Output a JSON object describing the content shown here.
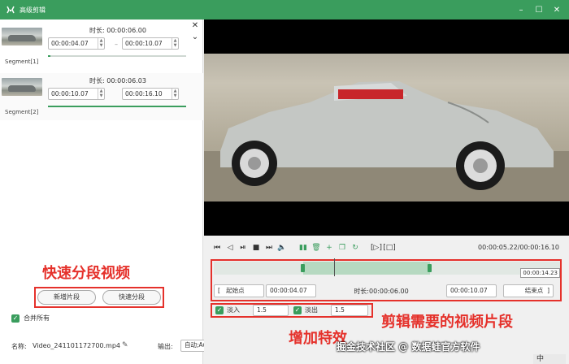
{
  "window": {
    "title": "高级剪辑"
  },
  "segments": [
    {
      "label": "Segment[1]",
      "duration_label": "时长:",
      "duration": "00:00:06.00",
      "start": "00:00:04.07",
      "end": "00:00:10.07",
      "progress": 0.0
    },
    {
      "label": "Segment[2]",
      "duration_label": "时长:",
      "duration": "00:00:06.03",
      "start": "00:00:10.07",
      "end": "00:00:16.10",
      "progress": 1.0
    }
  ],
  "left": {
    "annotation": "快速分段视频",
    "add_segment": "新增片段",
    "quick_split": "快速分段",
    "merge_all": "合并所有",
    "name_label": "名称:",
    "file_name": "Video_241101172700.mp4",
    "output_label": "输出:",
    "output_value": "自动;Auto"
  },
  "player": {
    "timecode": "00:00:05.22/00:00:16.10",
    "playhead_tooltip": "00:00:14.23",
    "playhead_position": 0.35,
    "range_start": 0.26,
    "range_end": 0.63
  },
  "trim": {
    "start_label": "起始点",
    "start": "00:00:04.07",
    "duration_label": "时长:",
    "duration": "00:00:06.00",
    "end": "00:00:10.07",
    "end_label": "结束点"
  },
  "effects": {
    "fade_in_label": "淡入",
    "fade_in": "1.5",
    "fade_out_label": "淡出",
    "fade_out": "1.5"
  },
  "annotations": {
    "clip": "剪辑需要的视频片段",
    "effects": "增加特效"
  },
  "watermark": "掘金技术社区 @ 数据蛙官方软件",
  "ime": "中",
  "colors": {
    "accent": "#3a9d5d",
    "annotation": "#e5312b"
  }
}
